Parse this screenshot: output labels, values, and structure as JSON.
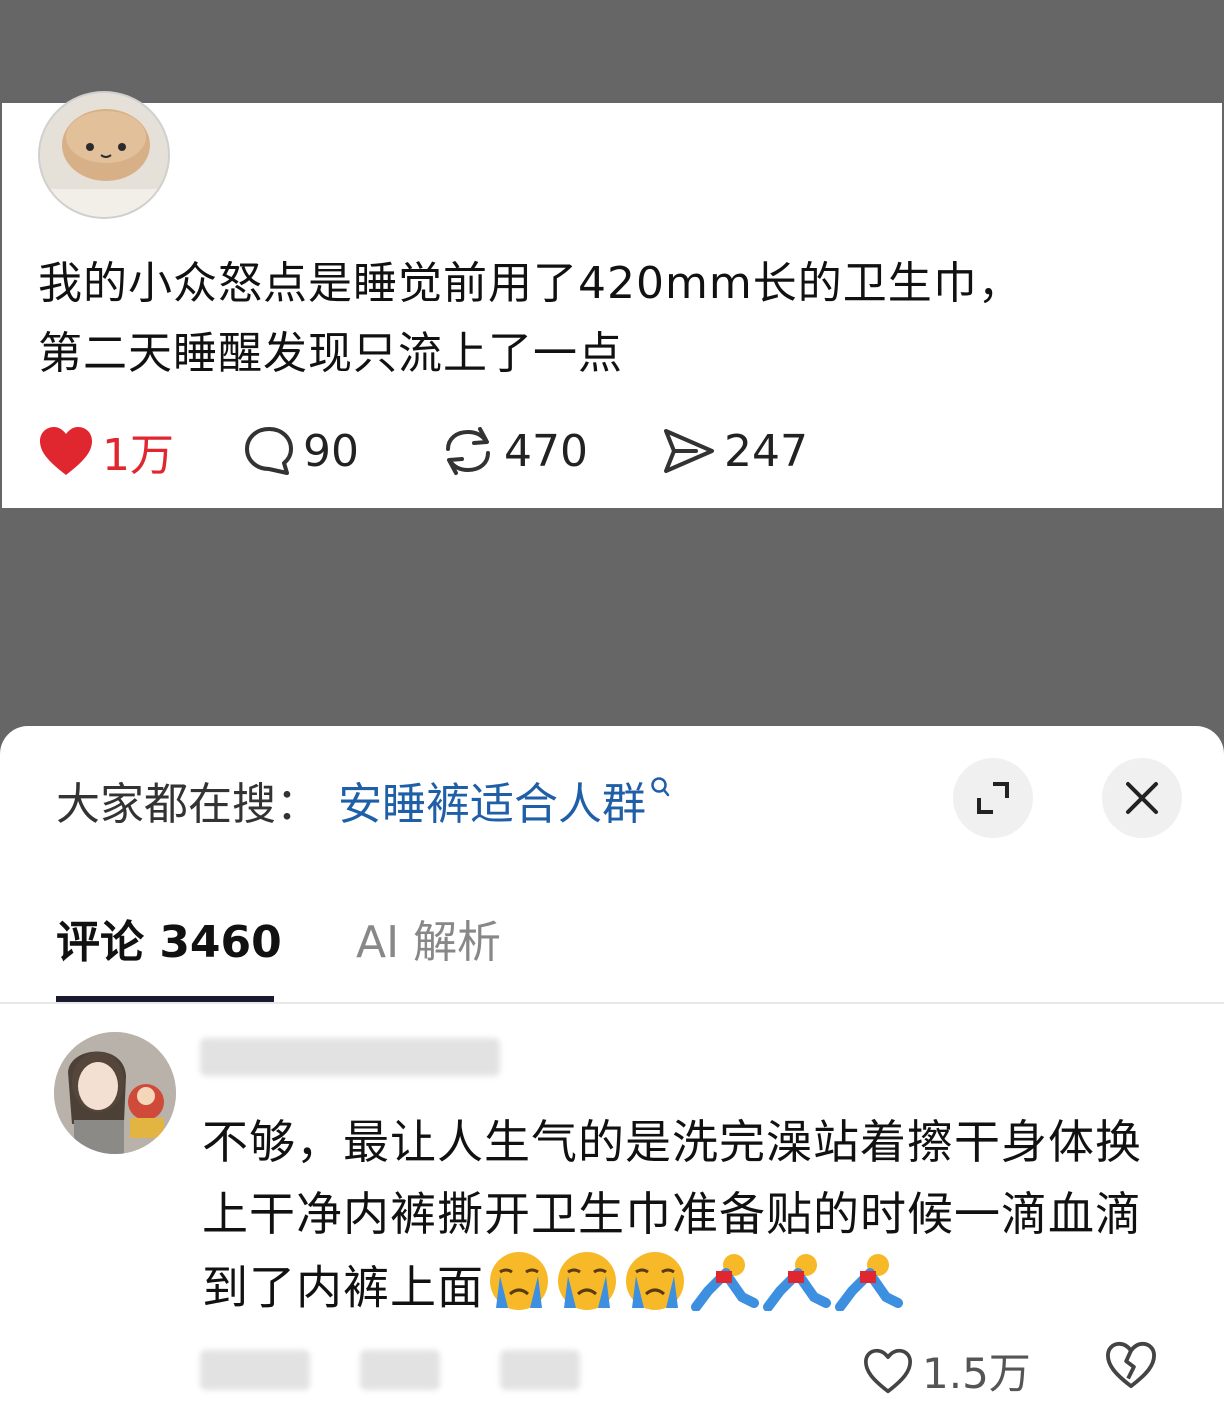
{
  "post": {
    "text_line1": "我的小众怒点是睡觉前用了420mm长的卫生巾，",
    "text_line2": "第二天睡醒发现只流上了一点",
    "likes": "1万",
    "comments": "90",
    "reposts": "470",
    "shares": "247"
  },
  "sheet": {
    "search_prefix": "大家都在搜：",
    "search_term": "安睡裤适合人群",
    "tabs": [
      {
        "label": "评论 3460"
      },
      {
        "label": "AI 解析"
      }
    ],
    "comment": {
      "text": "不够，最让人生气的是洗完澡站着擦干身体换上干净内裤撕开卫生巾准备贴的时候一滴血滴到了内裤上面",
      "emojis": [
        "crying-emoji",
        "crying-emoji",
        "crying-emoji",
        "fall-emoji",
        "fall-emoji",
        "fall-emoji"
      ],
      "likes": "1.5万"
    }
  },
  "colors": {
    "like_red": "#e0262f",
    "link_blue": "#1f5fa8",
    "backdrop": "#666666"
  }
}
